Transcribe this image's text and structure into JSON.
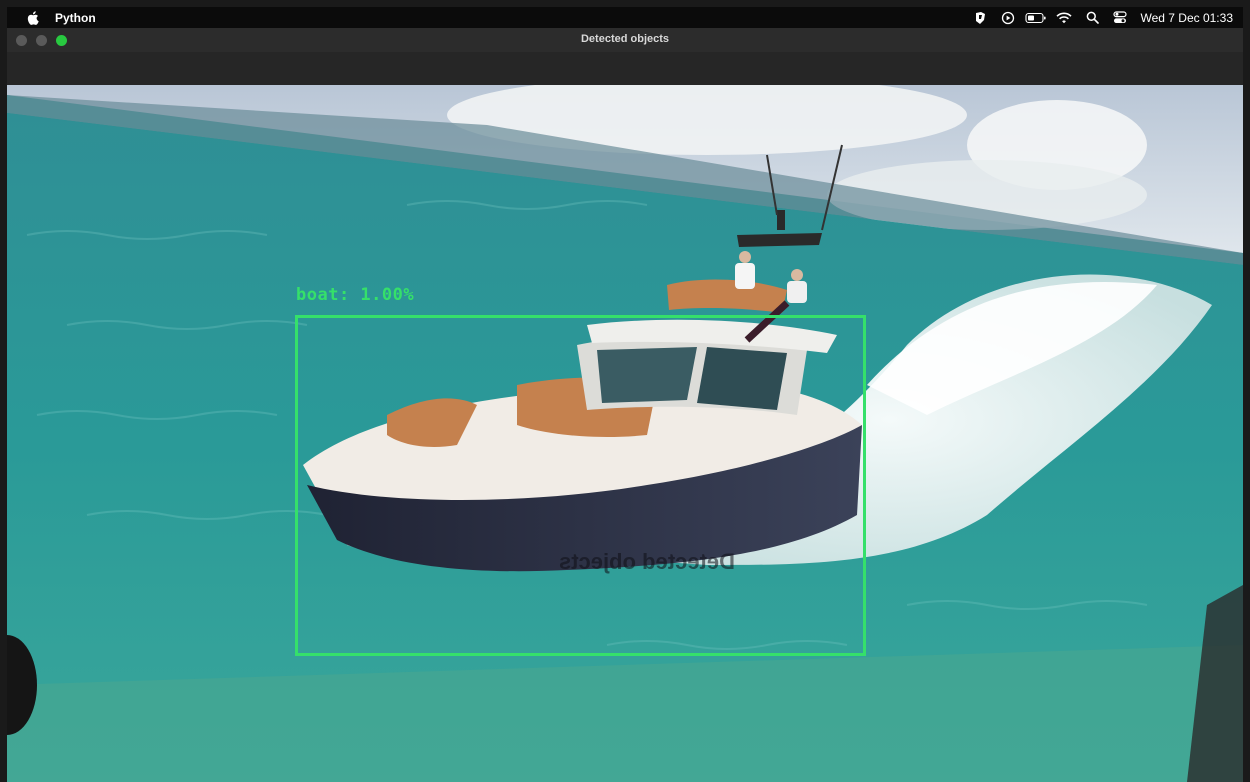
{
  "menubar": {
    "app_name": "Python",
    "clock": "Wed 7 Dec 01:33",
    "status_icons": [
      "apple-icon",
      "shield-icon",
      "play-icon",
      "battery-icon",
      "wifi-icon",
      "search-icon",
      "control-center-icon"
    ]
  },
  "window": {
    "title": "Detected objects"
  },
  "detection": {
    "label": "boat:  1.00%",
    "class": "boat",
    "confidence": "1.00%",
    "box_color": "#35e06a"
  },
  "watermark_text": "Detected objects"
}
